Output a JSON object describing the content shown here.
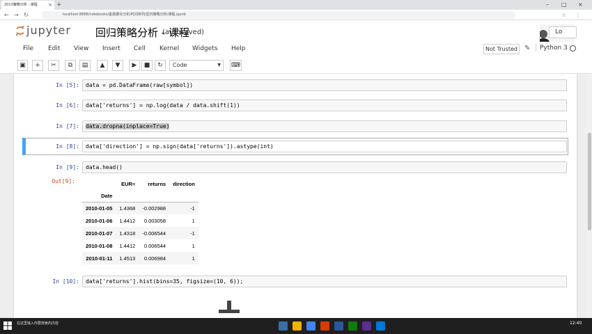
{
  "browser": {
    "tab_title": "2013策略分析 - 课程",
    "url": "localhost:8888/notebooks/金融量化分析/时间序列/回归策略分析/课程.ipynb"
  },
  "header": {
    "logo_text": "jupyter",
    "notebook_title": "回归策略分析 - 课程",
    "autosave": "(autosaved)",
    "logout": "Lo"
  },
  "menu": {
    "items": [
      "File",
      "Edit",
      "View",
      "Insert",
      "Cell",
      "Kernel",
      "Widgets",
      "Help"
    ],
    "not_trusted": "Not Trusted",
    "kernel": "Python 3"
  },
  "toolbar": {
    "cell_type": "Code"
  },
  "cells": [
    {
      "prompt": "In  [5]:",
      "code": "data = pd.DataFrame(raw[symbol])"
    },
    {
      "prompt": "In  [6]:",
      "code": "data['returns'] = np.log(data / data.shift(1))"
    },
    {
      "prompt": "In  [7]:",
      "code": "data.dropna(inplace=True)"
    },
    {
      "prompt": "In  [8]:",
      "code": "data['direction'] = np.sign(data['returns']).astype(int)"
    },
    {
      "prompt": "In  [9]:",
      "code": "data.head()"
    },
    {
      "prompt": "In  [10]:",
      "code": "data['returns'].hist(bins=35, figsize=(10, 6));"
    }
  ],
  "output": {
    "prompt": "Out[9]:",
    "columns": [
      "EUR=",
      "returns",
      "direction"
    ],
    "index_name": "Date",
    "rows": [
      {
        "date": "2010-01-05",
        "eur": "1.4368",
        "returns": "-0.002988",
        "direction": "-1"
      },
      {
        "date": "2010-01-06",
        "eur": "1.4412",
        "returns": "0.003058",
        "direction": "1"
      },
      {
        "date": "2010-01-07",
        "eur": "1.4318",
        "returns": "-0.006544",
        "direction": "-1"
      },
      {
        "date": "2010-01-08",
        "eur": "1.4412",
        "returns": "0.006544",
        "direction": "1"
      },
      {
        "date": "2010-01-11",
        "eur": "1.4513",
        "returns": "0.006984",
        "direction": "1"
      }
    ]
  },
  "taskbar": {
    "search_text": "在这里输入你要搜索的内容",
    "time": "12:40"
  },
  "colors": {
    "selected_cell_bar": "#42a5f5",
    "in_prompt": "#303f9f",
    "out_prompt": "#d84315"
  }
}
